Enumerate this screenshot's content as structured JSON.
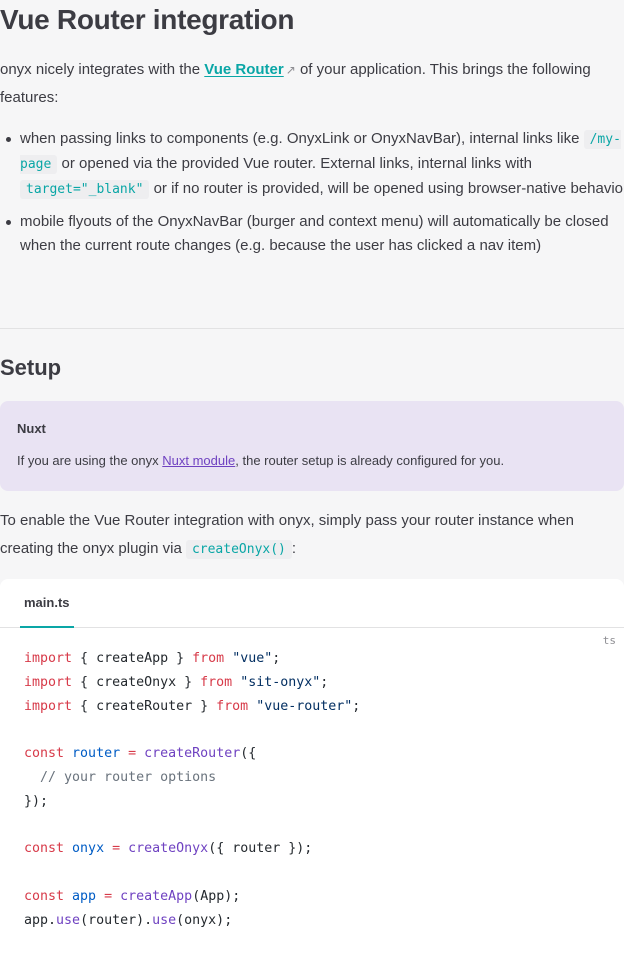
{
  "heading": "Vue Router integration",
  "intro": {
    "before_link": "onyx nicely integrates with the ",
    "link_text": "Vue Router",
    "link_icon": "external-link-icon",
    "after_link": " of your application. This brings the following features:"
  },
  "features": [
    {
      "t1": "when passing links to components (e.g. OnyxLink or OnyxNavBar), internal links like ",
      "code1": "/my-page",
      "t2": " or opened via the provided Vue router. External links, internal links with ",
      "code2": "target=\"_blank\"",
      "t3": " or if no router is provided, will be opened using browser-native behavior."
    },
    {
      "t1": "mobile flyouts of the OnyxNavBar (burger and context menu) will automatically be closed when the current route changes (e.g. because the user has clicked a nav item)"
    }
  ],
  "setup_heading": "Setup",
  "callout": {
    "title": "Nuxt",
    "before_link": "If you are using the onyx ",
    "link_text": "Nuxt module",
    "after_link": ", the router setup is already configured for you."
  },
  "enable": {
    "text": "To enable the Vue Router integration with onyx, simply pass your router instance when creating the onyx plugin via ",
    "code": "createOnyx()",
    "after": ":"
  },
  "code_block": {
    "tab": "main.ts",
    "lang": "ts",
    "lines": [
      "import { createApp } from \"vue\";",
      "import { createOnyx } from \"sit-onyx\";",
      "import { createRouter } from \"vue-router\";",
      "",
      "const router = createRouter({",
      "  // your router options",
      "});",
      "",
      "const onyx = createOnyx({ router });",
      "",
      "const app = createApp(App);",
      "app.use(router).use(onyx);"
    ]
  },
  "colors": {
    "accent": "#0aa6a6",
    "callout_bg": "#e9e3f3",
    "keyword": "#d73a49",
    "string": "#032f62",
    "function": "#6f42c1",
    "variable": "#005cc5"
  }
}
